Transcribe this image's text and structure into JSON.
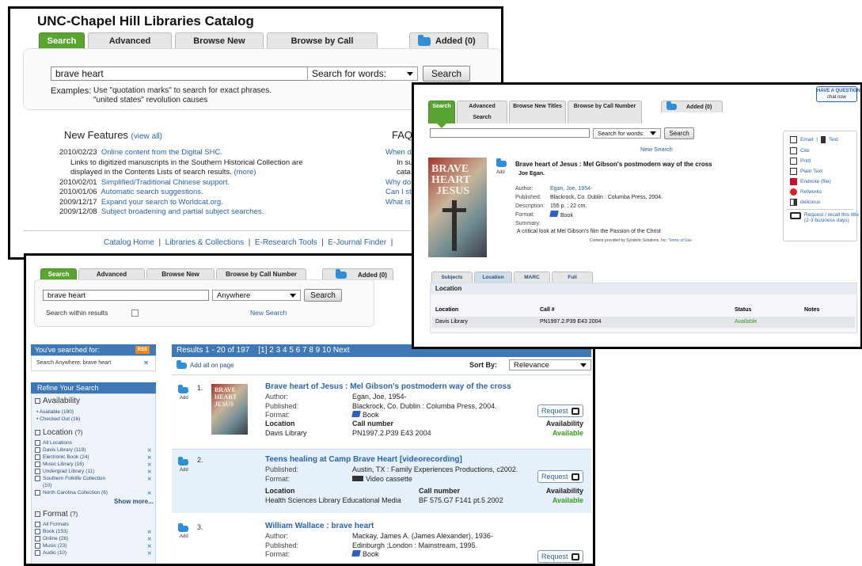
{
  "p1": {
    "title": "UNC-Chapel Hill Libraries Catalog",
    "tabs": [
      "Search",
      "Advanced Search",
      "Browse New Titles",
      "Browse by Call Number"
    ],
    "added": "Added (0)",
    "search_value": "brave heart",
    "select_value": "Search for words:",
    "search_button": "Search",
    "examples_label": "Examples:",
    "examples_line1": "Use \"quotation marks\" to search for exact phrases.",
    "examples_line2": "\"united states\" revolution causes",
    "features_title": "New Features",
    "view_all": "(view all)",
    "news": [
      {
        "date": "2010/02/23",
        "text": "Online content from the Digital SHC."
      },
      {
        "date": "2010/02/01",
        "text": "Simplified/Traditional Chinese support."
      },
      {
        "date": "2010/01/06",
        "text": "Automatic search suggestions."
      },
      {
        "date": "2009/12/17",
        "text": "Expand your search to Worldcat.org."
      },
      {
        "date": "2009/12/08",
        "text": "Subject broadening and partial subject searches."
      }
    ],
    "news_desc1": "Links to digitized manuscripts in the Southern Historical Collection are",
    "news_desc2": "displayed in the Contents Lists of search results.",
    "more": "(more)",
    "faq_title": "FAQ",
    "faq_lines": [
      "When d",
      "In su",
      "cata",
      "Why do",
      "Can I st",
      "What is"
    ],
    "footer": [
      "Catalog Home",
      "Libraries & Collections",
      "E-Research Tools",
      "E-Journal Finder"
    ]
  },
  "p2": {
    "tabs": [
      "Search",
      "Advanced Search",
      "Browse New Titles",
      "Browse by Call Number"
    ],
    "added": "Added (0)",
    "search_value": "brave heart",
    "select_value": "Anywhere",
    "search_button": "Search",
    "within_label": "Search within results",
    "new_search": "New Search",
    "searched_for_title": "You've searched for:",
    "rss": "RSS",
    "searched_item": "Search Anywhere: brave heart",
    "refine_title": "Refine Your Search",
    "availability_title": "Availability",
    "availability_items": [
      "Available (190)",
      "Checked Out (16)"
    ],
    "location_title": "Location",
    "location_help": "(?)",
    "location_items": [
      "All Locations",
      "Davis Library (119)",
      "Electronic Book (24)",
      "Music Library (16)",
      "Undergrad Library (11)",
      "Southern Folklife Collection",
      "(10)",
      "North Carolina Collection (6)"
    ],
    "show_more": "Show more...",
    "format_title": "Format",
    "format_help": "(?)",
    "format_items": [
      "All Formats",
      "Book (153)",
      "Online (26)",
      "Music (23)",
      "Audio (10)"
    ],
    "results_header": "Results 1 - 20 of 197",
    "pages": "[1]  2  3  4  5  6  7  8  9  10  Next",
    "add_all": "Add all on page",
    "sort_label": "Sort By:",
    "sort_value": "Relevance",
    "add_label": "Add",
    "results": [
      {
        "num": "1.",
        "title": "Brave heart of Jesus : Mel Gibson's postmodern way of the cross",
        "fields": [
          [
            "Author:",
            "Egan, Joe, 1954-"
          ],
          [
            "Published:",
            "Blackrock, Co. Dublin : Columba Press, 2004."
          ],
          [
            "Format:",
            "Book"
          ]
        ],
        "location_label": "Location",
        "location": "Davis Library",
        "call_label": "Call number",
        "call": "PN1997.2.P39 E43 2004",
        "avail_label": "Availability",
        "avail": "Available",
        "request": "Request"
      },
      {
        "num": "2.",
        "title": "Teens healing at Camp Brave Heart [videorecording]",
        "fields": [
          [
            "Published:",
            "Austin, TX : Family Experiences Productions, c2002."
          ],
          [
            "Format:",
            "Video cassette"
          ]
        ],
        "location_label": "Location",
        "location": "Health Sciences Library Educational Media",
        "call_label": "Call number",
        "call": "BF 575.G7 F141 pt.5 2002",
        "avail_label": "Availability",
        "avail": "Available",
        "request": "Request"
      },
      {
        "num": "3.",
        "title": "William Wallace : brave heart",
        "fields": [
          [
            "Author:",
            "Mackay, James A. (James Alexander), 1936-"
          ],
          [
            "Published:",
            "Edinburgh ;London : Mainstream, 1995."
          ],
          [
            "Format:",
            "Book"
          ]
        ],
        "request": "Request"
      }
    ],
    "thumb_text": [
      "BRAVE",
      "HEART",
      "JESUS"
    ]
  },
  "p3": {
    "tabs": [
      "Search",
      "Advanced Search",
      "Browse New Titles",
      "Browse by Call Number"
    ],
    "added": "Added (0)",
    "have_question": "HAVE A QUESTION",
    "chat_now": "chat now",
    "select_value": "Search for words:",
    "search_button": "Search",
    "new_search": "New Search",
    "title": "Brave heart of Jesus : Mel Gibson's postmodern way of the cross",
    "author_line": "Joe Egan.",
    "add_label": "Add",
    "fields": [
      [
        "Author:",
        "Egan, Joe, 1954-"
      ],
      [
        "Published:",
        "Blackrock, Co. Dublin : Columba Press, 2004."
      ],
      [
        "Description:",
        "155 p. ; 22 cm."
      ],
      [
        "Format:",
        "Book"
      ],
      [
        "Summary:",
        ""
      ]
    ],
    "summary": "A critical look at Mel Gibson's film the Passion of the Christ",
    "content_by": "Content provided by Syndetic Solutions, Inc.",
    "terms": "Terms of Use",
    "cover_text": [
      "BRAVE",
      "HEART",
      "JESUS"
    ],
    "tools": [
      "Email",
      "Text",
      "Cite",
      "Print",
      "Plain Text",
      "Endnote (file)",
      "Refworks",
      "delicious"
    ],
    "request_line1": "Request / recall this title",
    "request_line2": "(2-3 business days)",
    "detail_tabs": [
      "Subjects",
      "Location",
      "MARC",
      "Full Record"
    ],
    "location_header": "Location",
    "cols": [
      "Location",
      "Call #",
      "Status",
      "Notes"
    ],
    "row": [
      "Davis Library",
      "PN1997.2.P39 E43 2004",
      "Available",
      ""
    ]
  }
}
